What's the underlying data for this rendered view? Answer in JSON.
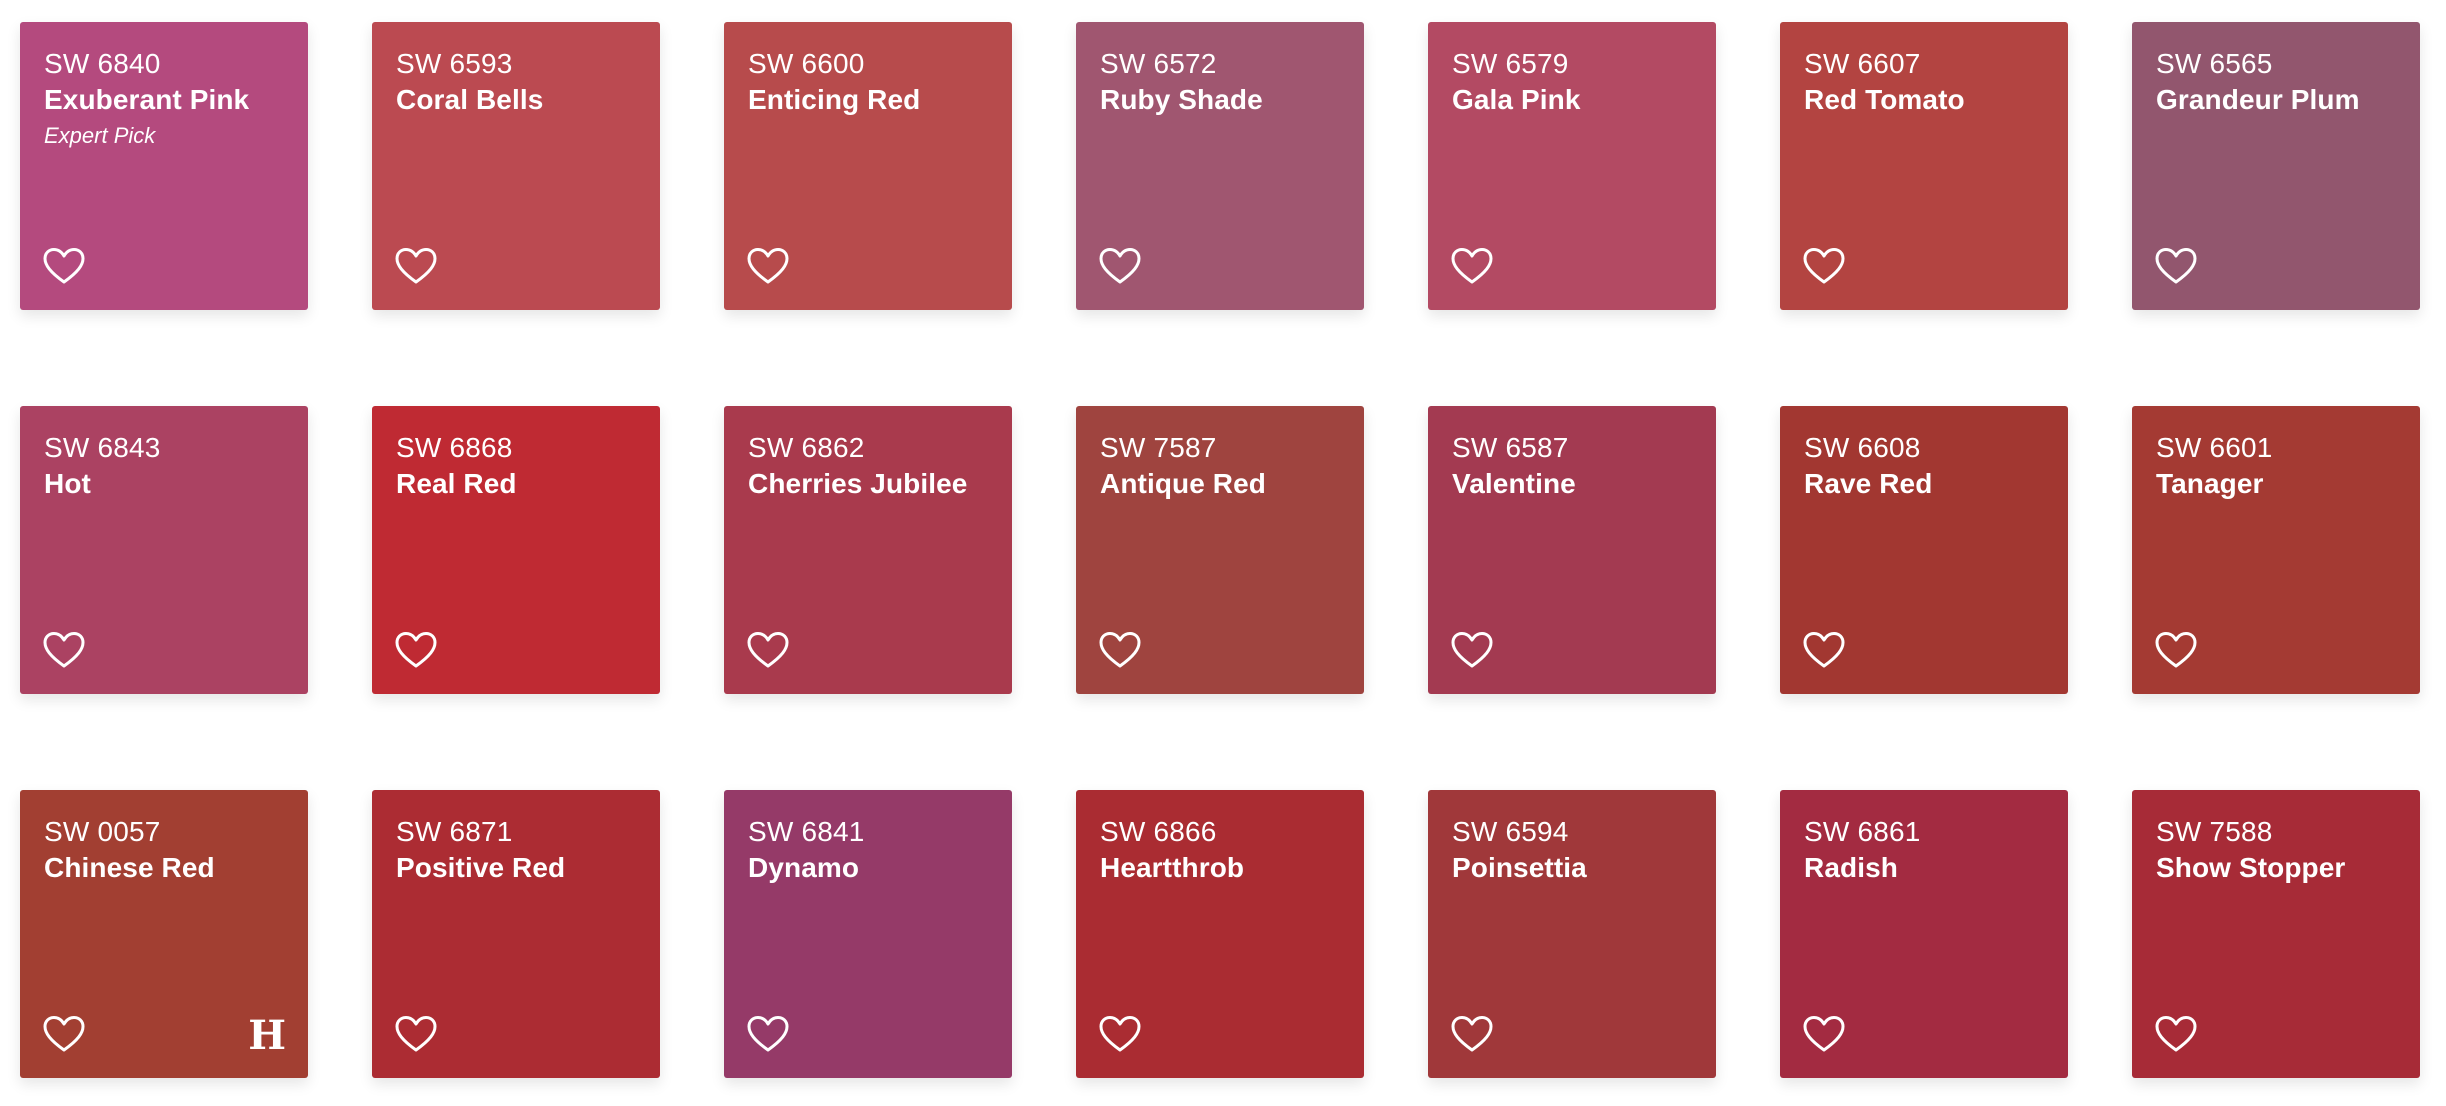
{
  "swatches": [
    {
      "code": "SW 6840",
      "name": "Exuberant Pink",
      "badge": "Expert Pick",
      "color": "#b44a7e"
    },
    {
      "code": "SW 6593",
      "name": "Coral Bells",
      "color": "#bb4a51"
    },
    {
      "code": "SW 6600",
      "name": "Enticing Red",
      "color": "#b74b4c"
    },
    {
      "code": "SW 6572",
      "name": "Ruby Shade",
      "color": "#a05670"
    },
    {
      "code": "SW 6579",
      "name": "Gala Pink",
      "color": "#b34a63"
    },
    {
      "code": "SW 6607",
      "name": "Red Tomato",
      "color": "#b34441"
    },
    {
      "code": "SW 6565",
      "name": "Grandeur Plum",
      "color": "#92566e"
    },
    {
      "code": "SW 6843",
      "name": "Hot",
      "color": "#ab4262"
    },
    {
      "code": "SW 6868",
      "name": "Real Red",
      "color": "#bf2a33"
    },
    {
      "code": "SW 6862",
      "name": "Cherries Jubilee",
      "color": "#a93a4d"
    },
    {
      "code": "SW 7587",
      "name": "Antique Red",
      "color": "#9f443f"
    },
    {
      "code": "SW 6587",
      "name": "Valentine",
      "color": "#a33a51"
    },
    {
      "code": "SW 6608",
      "name": "Rave Red",
      "color": "#a23731"
    },
    {
      "code": "SW 6601",
      "name": "Tanager",
      "color": "#a43a33"
    },
    {
      "code": "SW 0057",
      "name": "Chinese Red",
      "color": "#a23f32",
      "brand_mark": "H"
    },
    {
      "code": "SW 6871",
      "name": "Positive Red",
      "color": "#ac2c33"
    },
    {
      "code": "SW 6841",
      "name": "Dynamo",
      "color": "#953a68"
    },
    {
      "code": "SW 6866",
      "name": "Heartthrob",
      "color": "#aa2c32"
    },
    {
      "code": "SW 6594",
      "name": "Poinsettia",
      "color": "#a0383a"
    },
    {
      "code": "SW 6861",
      "name": "Radish",
      "color": "#a32b41"
    },
    {
      "code": "SW 7588",
      "name": "Show Stopper",
      "color": "#a72b37"
    }
  ],
  "icons": {
    "favorite": "heart-outline-icon",
    "brand": "hgtv-home-logo-icon"
  }
}
